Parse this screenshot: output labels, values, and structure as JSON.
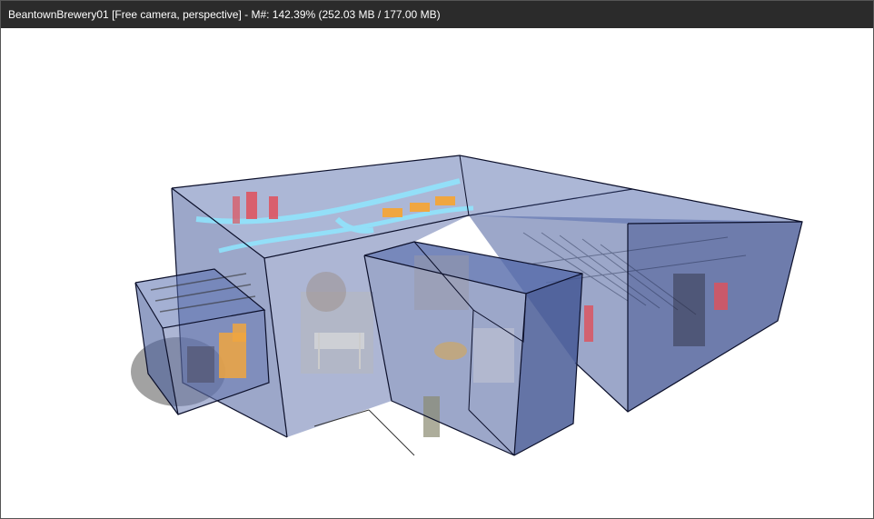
{
  "window": {
    "title": "BeantownBrewery01 [Free camera, perspective] - M#: 142.39% (252.03 MB / 177.00 MB)"
  },
  "viewport": {
    "camera_mode": "Free camera, perspective",
    "scene_name": "BeantownBrewery01"
  },
  "colors": {
    "titlebar_bg": "#2b2b2b",
    "viewport_bg": "#ffffff",
    "volume_fill": "#4a5f9c",
    "volume_edge": "#0b0f2a",
    "pipe": "#8fe6ff",
    "orange": "#f0a640",
    "red": "#e0505a"
  }
}
